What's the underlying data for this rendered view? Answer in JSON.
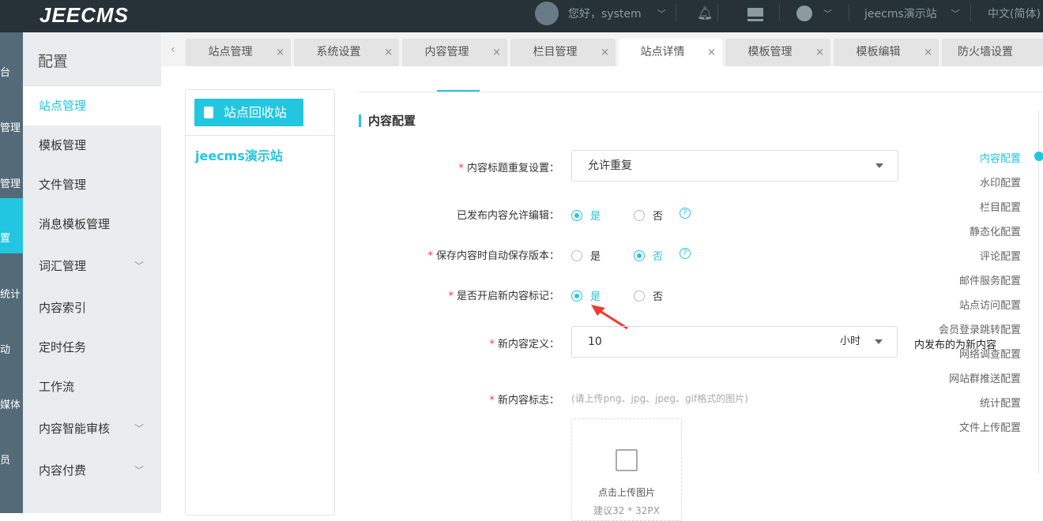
{
  "header": {
    "logo": "JEECMS",
    "greeting": "您好，system",
    "site": "jeecms演示站",
    "language": "中文(简体)"
  },
  "rail": {
    "items": [
      "台",
      "管理",
      "管理",
      "置",
      "统计",
      "动",
      "媒体",
      "员"
    ]
  },
  "menu": {
    "title": "配置",
    "items": [
      {
        "label": "站点管理",
        "active": true
      },
      {
        "label": "模板管理"
      },
      {
        "label": "文件管理"
      },
      {
        "label": "消息模板管理"
      },
      {
        "label": "词汇管理",
        "expand": true
      },
      {
        "label": "内容索引"
      },
      {
        "label": "定时任务"
      },
      {
        "label": "工作流"
      },
      {
        "label": "内容智能审核",
        "expand": true
      },
      {
        "label": "内容付费",
        "expand": true
      }
    ]
  },
  "tabs": [
    "站点管理",
    "系统设置",
    "内容管理",
    "栏目管理",
    "站点详情",
    "模板管理",
    "模板编辑",
    "防火墙设置"
  ],
  "left_panel": {
    "recycle_button": "站点回收站",
    "site": "jeecms演示站"
  },
  "form": {
    "section_title": "内容配置",
    "title_repeat": {
      "label": "内容标题重复设置：",
      "value": "允许重复"
    },
    "allow_edit": {
      "label": "已发布内容允许编辑：",
      "yes": "是",
      "no": "否",
      "selected": "yes"
    },
    "auto_version": {
      "label": "保存内容时自动保存版本：",
      "yes": "是",
      "no": "否",
      "selected": "no"
    },
    "new_mark": {
      "label": "是否开启新内容标记：",
      "yes": "是",
      "no": "否",
      "selected": "yes"
    },
    "new_def": {
      "label": "新内容定义：",
      "value": "10",
      "unit": "小时",
      "tooltip": "内发布的为新内容"
    },
    "new_icon": {
      "label": "新内容标志：",
      "hint": "(请上传png、jpg、jpeg、gif格式的图片)",
      "upload": "点击上传图片",
      "size": "建议32 * 32PX"
    }
  },
  "anchors": [
    "内容配置",
    "水印配置",
    "栏目配置",
    "静态化配置",
    "评论配置",
    "邮件服务配置",
    "站点访问配置",
    "会员登录跳转配置",
    "网络调查配置",
    "网站群推送配置",
    "统计配置",
    "文件上传配置"
  ],
  "colors": {
    "accent": "#22c6e0",
    "header": "#263238"
  }
}
